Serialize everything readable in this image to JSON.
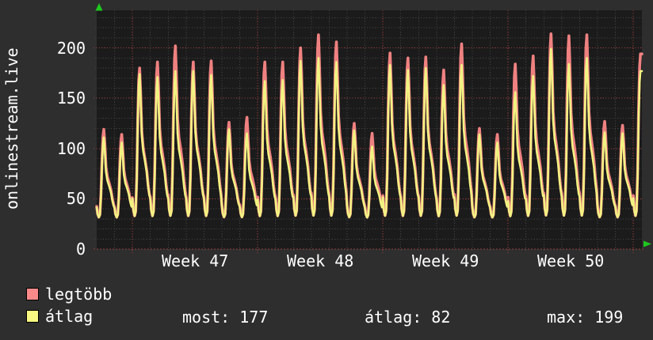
{
  "site_label": "onlinestream.live",
  "legend": {
    "items": [
      {
        "label": "legtöbb",
        "swatch_color": "#fa8a8a"
      },
      {
        "label": "átlag",
        "swatch_color": "#f8f882"
      }
    ]
  },
  "stats": [
    {
      "label": "most",
      "value": 177,
      "text": "most: 177"
    },
    {
      "label": "átlag",
      "value": 82,
      "text": "átlag: 82"
    },
    {
      "label": "max",
      "value": 199,
      "text": "max: 199"
    }
  ],
  "chart_data": {
    "type": "line",
    "title": "",
    "xlabel": "",
    "ylabel": "",
    "ylim": [
      0,
      237
    ],
    "yticks": [
      200,
      150,
      100,
      50,
      0
    ],
    "grid": {
      "on": true,
      "minor_step": 10,
      "major_step": 50,
      "gray_color": "#414141",
      "red_color": "#9e4141",
      "baseline_color": "#8f3d3d"
    },
    "x_axis": {
      "week_labels": [
        "Week 47",
        "Week 48",
        "Week 49",
        "Week 50"
      ],
      "days_total": 30.48,
      "monday_day_indices": [
        2,
        9,
        16,
        23,
        30
      ]
    },
    "base_value": 30,
    "daily_profile": [
      [
        0.0,
        0.14
      ],
      [
        0.05,
        0.06
      ],
      [
        0.12,
        0.02
      ],
      [
        0.18,
        0.05
      ],
      [
        0.24,
        0.28
      ],
      [
        0.3,
        0.68
      ],
      [
        0.35,
        0.92
      ],
      [
        0.4,
        1.0
      ],
      [
        0.45,
        0.86
      ],
      [
        0.52,
        0.58
      ],
      [
        0.6,
        0.47
      ],
      [
        0.7,
        0.4
      ],
      [
        0.8,
        0.32
      ],
      [
        0.88,
        0.22
      ],
      [
        0.95,
        0.16
      ]
    ],
    "series": [
      {
        "name": "legtöbb",
        "color": "#ef8181",
        "stroke_width": 3.6,
        "daily_peaks": [
          119,
          114,
          180,
          186,
          202,
          186,
          187,
          126,
          131,
          186,
          186,
          200,
          213,
          206,
          125,
          115,
          195,
          190,
          191,
          178,
          204,
          120,
          114,
          184,
          192,
          214,
          212,
          213,
          127,
          123,
          194
        ]
      },
      {
        "name": "átlag",
        "color": "#f2f282",
        "stroke_width": 2.6,
        "daily_peaks": [
          111,
          106,
          174,
          171,
          177,
          177,
          173,
          119,
          115,
          167,
          168,
          187,
          190,
          186,
          118,
          102,
          183,
          178,
          180,
          163,
          183,
          114,
          106,
          156,
          172,
          199,
          184,
          190,
          116,
          115,
          177
        ]
      }
    ],
    "summary": {
      "most": 177,
      "atlag": 82,
      "max": 199
    },
    "legend_position": "bottom-left"
  },
  "arrow_color": "#1ec91e"
}
